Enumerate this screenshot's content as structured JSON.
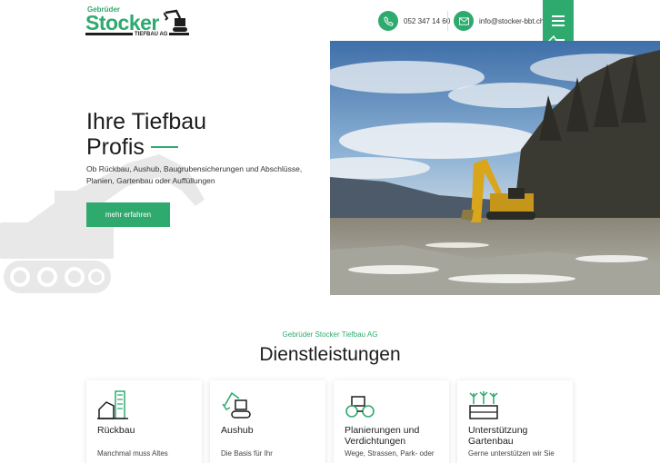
{
  "header": {
    "logo": {
      "top_text": "Gebrüder",
      "name": "Stocker",
      "sub": "TIEFBAU AG"
    },
    "phone": {
      "icon": "phone-icon",
      "label": "052 347 14 60"
    },
    "email": {
      "icon": "mail-icon",
      "label": "info@stocker-bbt.ch"
    },
    "menu": {
      "icon": "hamburger-icon"
    }
  },
  "hero": {
    "title_line1": "Ihre Tiefbau",
    "title_line2": "Profis",
    "text": "Ob Rückbau, Aushub, Baugrubensicherungen und Abschlüsse, Planien, Gartenbau oder Auffüllungen",
    "button": "mehr erfahren",
    "image": "excavator-construction-site-photo"
  },
  "services": {
    "eyebrow": "Gebrüder Stocker Tiefbau AG",
    "title": "Dienstleistungen",
    "cards": [
      {
        "icon": "demolition-icon",
        "title": "Rückbau",
        "desc": "Manchmal muss Altes"
      },
      {
        "icon": "excavator-icon",
        "title": "Aushub",
        "desc": "Die Basis für Ihr"
      },
      {
        "icon": "roller-icon",
        "title": "Planierungen und Verdichtungen",
        "desc": "Wege, Strassen, Park- oder"
      },
      {
        "icon": "garden-icon",
        "title": "Unterstützung Gartenbau",
        "desc": "Gerne unterstützen wir Sie"
      }
    ]
  },
  "colors": {
    "accent": "#2faa6e",
    "text": "#1d1d1d"
  }
}
